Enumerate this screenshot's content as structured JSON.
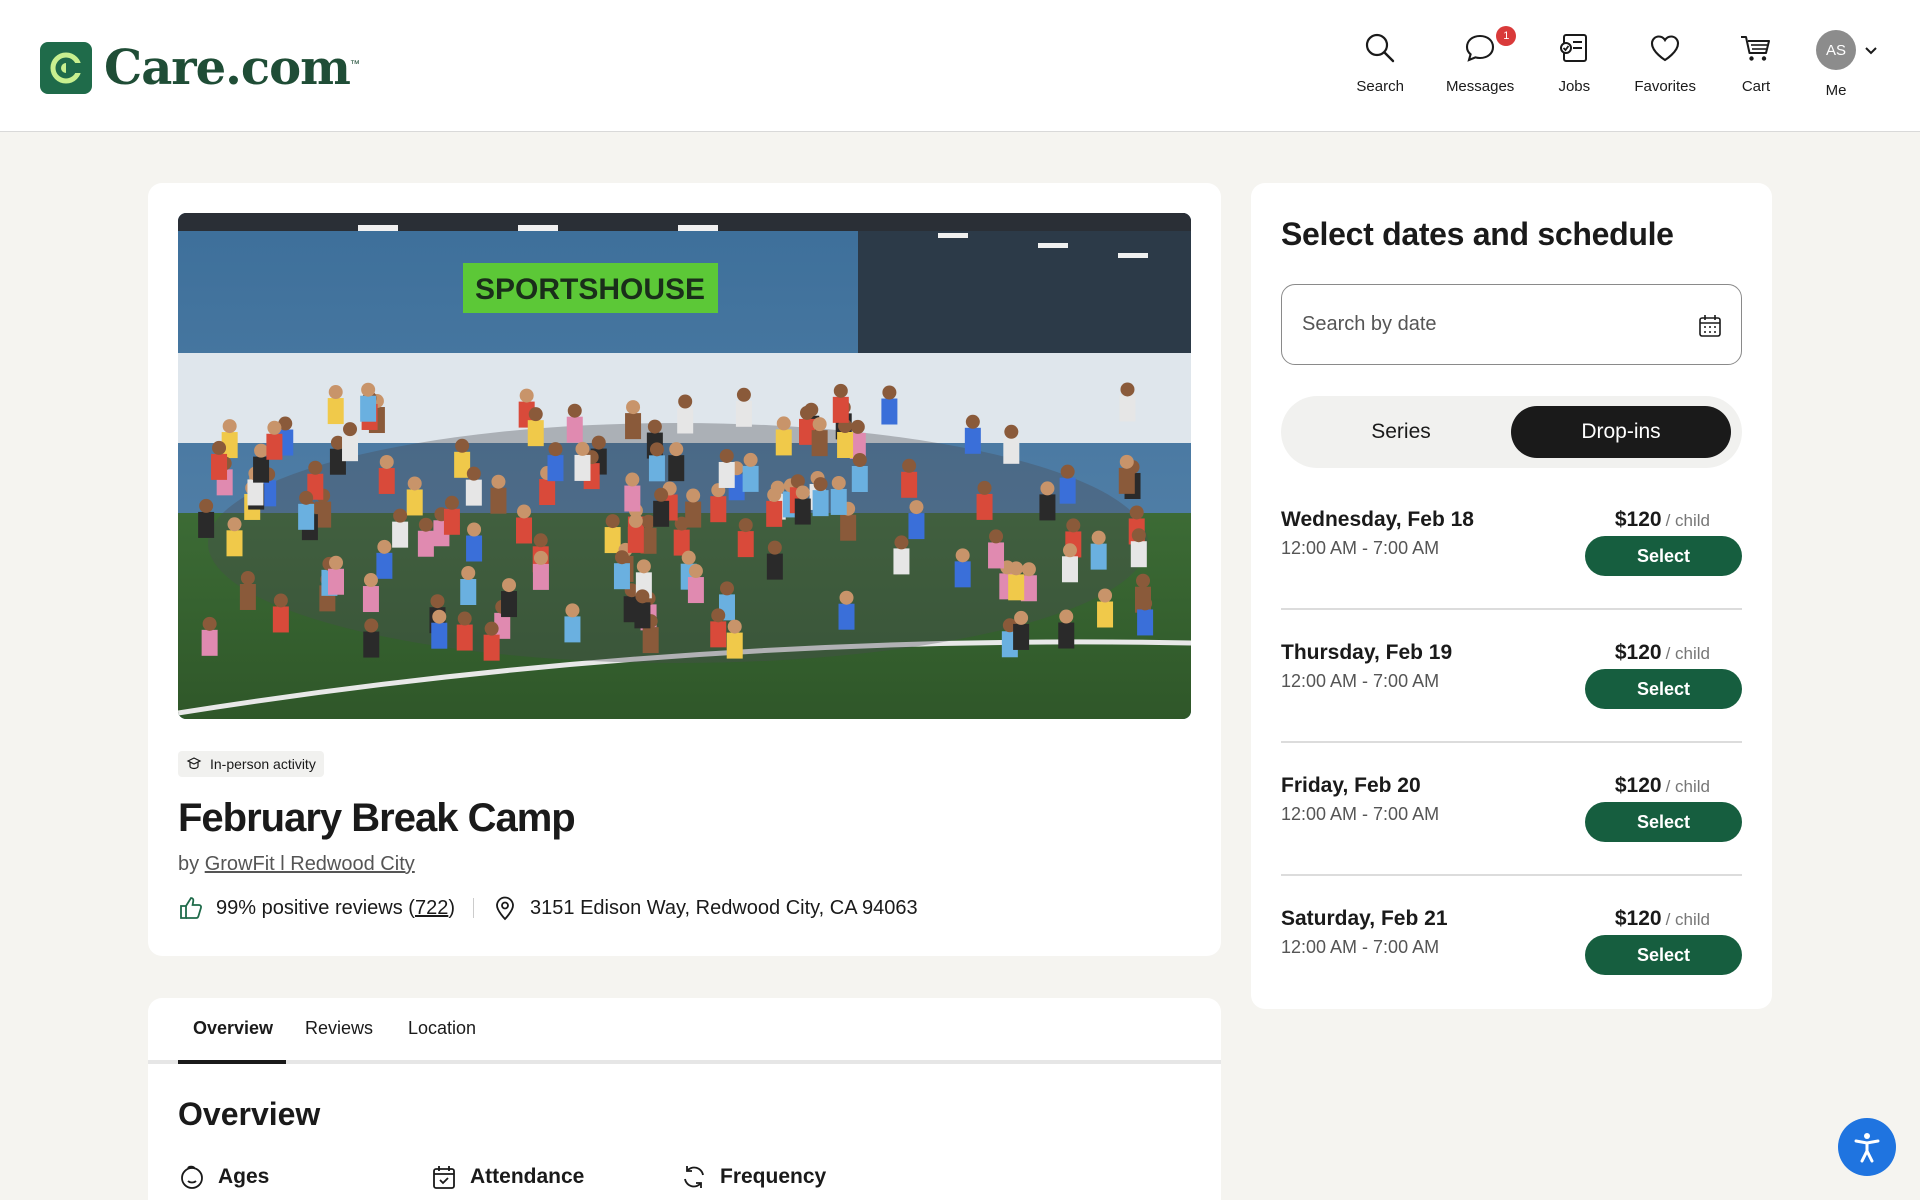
{
  "brand": {
    "name": "Care.com",
    "tm": "™",
    "color": "#1f6b4a"
  },
  "nav": {
    "items": [
      {
        "label": "Search",
        "icon": "search-icon"
      },
      {
        "label": "Messages",
        "icon": "chat-bubble-icon",
        "badge": "1"
      },
      {
        "label": "Jobs",
        "icon": "jobs-icon"
      },
      {
        "label": "Favorites",
        "icon": "heart-icon"
      },
      {
        "label": "Cart",
        "icon": "cart-icon"
      },
      {
        "label": "Me",
        "icon": "avatar",
        "initials": "AS"
      }
    ]
  },
  "listing": {
    "tag": "In-person activity",
    "title": "February Break Camp",
    "by_prefix": "by",
    "provider": "GrowFit l Redwood City",
    "reviews_text": "99% positive reviews (",
    "reviews_count": "722",
    "reviews_close": ")",
    "address": "3151 Edison Way, Redwood City, CA 94063",
    "hero_sign": "SPORTSHOUSE"
  },
  "tabs": {
    "items": [
      "Overview",
      "Reviews",
      "Location"
    ],
    "active": "Overview"
  },
  "overview": {
    "title": "Overview",
    "items": [
      "Ages",
      "Attendance",
      "Frequency"
    ]
  },
  "schedule": {
    "title": "Select dates and schedule",
    "search_placeholder": "Search by date",
    "toggle": {
      "series": "Series",
      "dropins": "Drop-ins",
      "active": "Drop-ins"
    },
    "rows": [
      {
        "date": "Wednesday, Feb 18",
        "time": "12:00 AM - 7:00 AM",
        "price": "$120",
        "unit": "/ child",
        "button": "Select"
      },
      {
        "date": "Thursday, Feb 19",
        "time": "12:00 AM - 7:00 AM",
        "price": "$120",
        "unit": "/ child",
        "button": "Select"
      },
      {
        "date": "Friday, Feb 20",
        "time": "12:00 AM - 7:00 AM",
        "price": "$120",
        "unit": "/ child",
        "button": "Select"
      },
      {
        "date": "Saturday, Feb 21",
        "time": "12:00 AM - 7:00 AM",
        "price": "$120",
        "unit": "/ child",
        "button": "Select"
      }
    ]
  },
  "colors": {
    "accent_green": "#165e3f",
    "badge_red": "#d93a3a",
    "a11y_blue": "#1f74e0"
  }
}
